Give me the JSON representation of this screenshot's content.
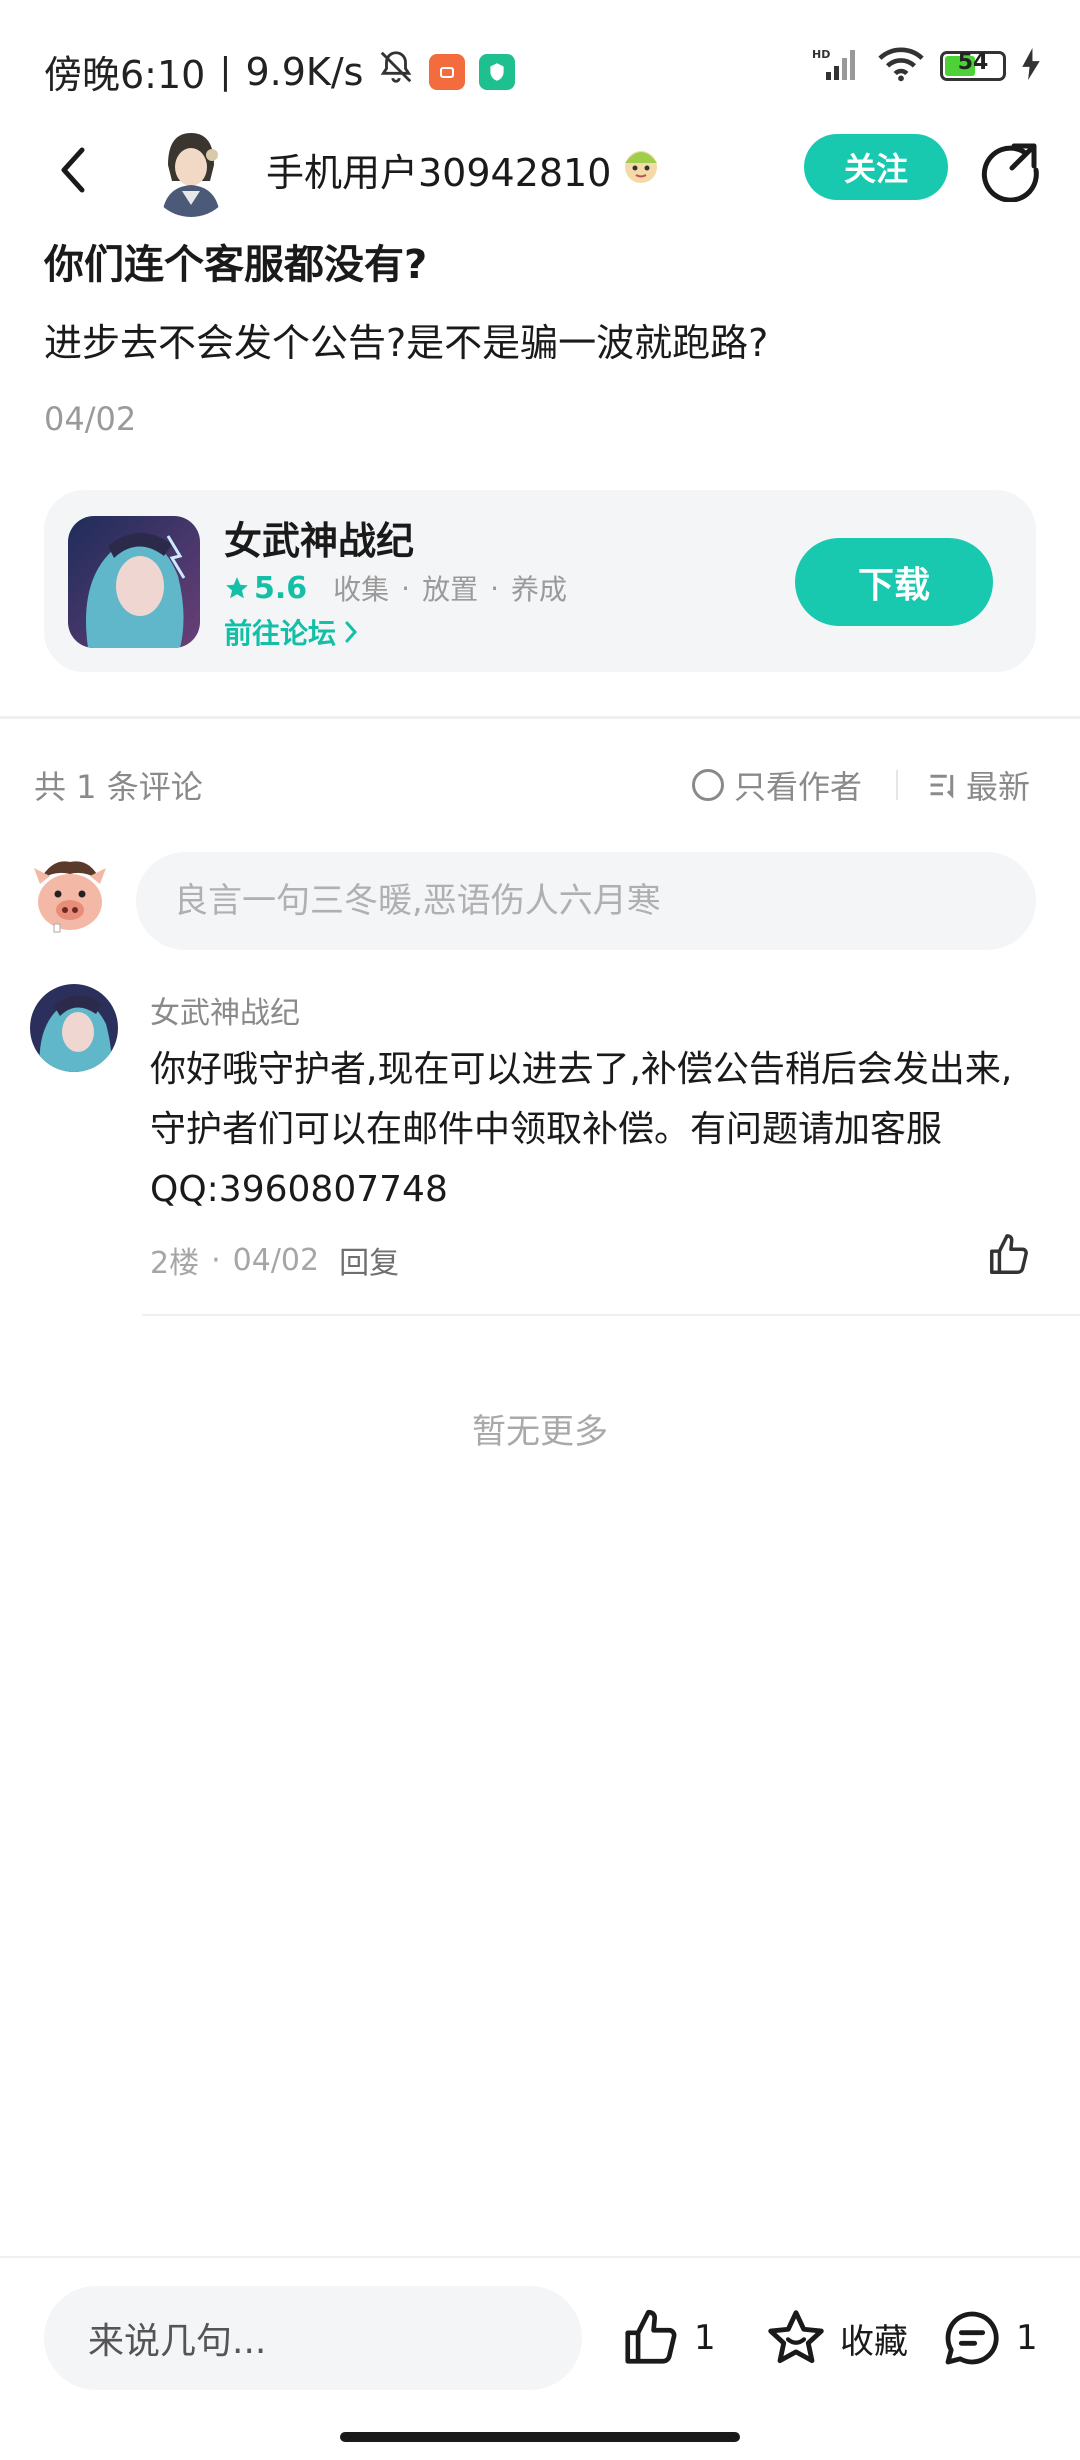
{
  "status_bar": {
    "time": "傍晚6:10",
    "speed": "9.9K/s",
    "battery_level": "54",
    "icons": [
      "bell-off-icon",
      "app-notification-icon",
      "shield-app-icon",
      "hd-signal-icon",
      "wifi-icon",
      "battery-icon",
      "charging-icon"
    ]
  },
  "header": {
    "author_name": "手机用户30942810",
    "follow_label": "关注"
  },
  "post": {
    "title": "你们连个客服都没有?",
    "body": "进步去不会发个公告?是不是骗一波就跑路?",
    "date": "04/02"
  },
  "game": {
    "name": "女武神战纪",
    "rating": "5.6",
    "tags": [
      "收集",
      "放置",
      "养成"
    ],
    "forum_link": "前往论坛",
    "download_label": "下载"
  },
  "comments_bar": {
    "count_label": "共 1 条评论",
    "author_only": "只看作者",
    "sort_label": "最新"
  },
  "composer": {
    "placeholder": "良言一句三冬暖,恶语伤人六月寒"
  },
  "comments": [
    {
      "name": "女武神战纪",
      "text": "你好哦守护者,现在可以进去了,补偿公告稍后会发出来,守护者们可以在邮件中领取补偿。有问题请加客服QQ:3960807748",
      "floor": "2楼",
      "date": "04/02",
      "reply_label": "回复"
    }
  ],
  "no_more": "暂无更多",
  "bottom_bar": {
    "input_placeholder": "来说几句...",
    "like_count": "1",
    "favorite_label": "收藏",
    "comment_count": "1"
  },
  "colors": {
    "accent": "#18c9b0",
    "muted_text": "#9a9a9a",
    "card_bg": "#f4f5f7"
  }
}
